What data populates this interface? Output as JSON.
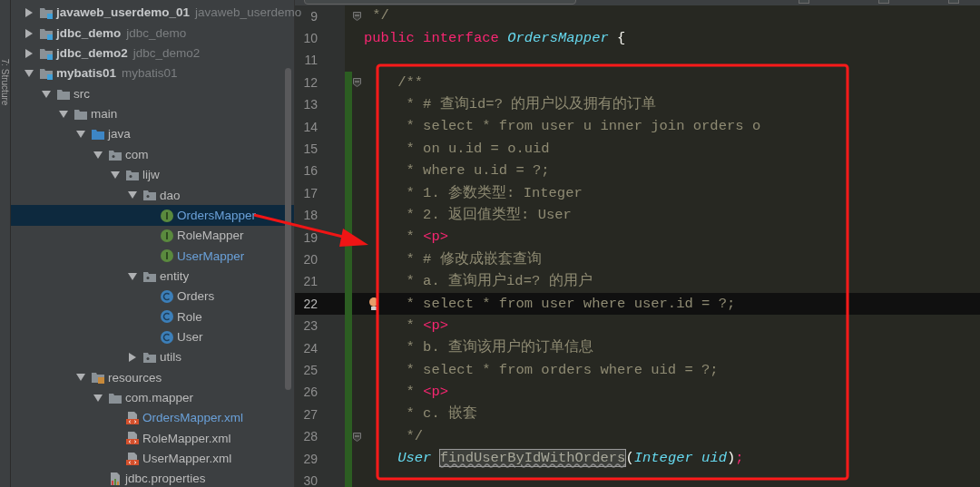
{
  "tool_strip": {
    "label": "7: Structure"
  },
  "project_tree": [
    {
      "label": "javaweb_userdemo_01",
      "secondary": "javaweb_userdemo",
      "kind": "module",
      "expanded": false,
      "modified": false
    },
    {
      "label": "jdbc_demo",
      "secondary": "jdbc_demo",
      "kind": "module",
      "expanded": false,
      "modified": false
    },
    {
      "label": "jdbc_demo2",
      "secondary": "jdbc_demo2",
      "kind": "module",
      "expanded": false,
      "modified": false
    },
    {
      "label": "mybatis01",
      "secondary": "mybatis01",
      "kind": "module",
      "expanded": true,
      "modified": false,
      "children": [
        {
          "label": "src",
          "kind": "folder",
          "expanded": true,
          "modified": false,
          "children": [
            {
              "label": "main",
              "kind": "folder",
              "expanded": true,
              "modified": false,
              "children": [
                {
                  "label": "java",
                  "kind": "source",
                  "expanded": true,
                  "modified": false,
                  "children": [
                    {
                      "label": "com",
                      "kind": "package",
                      "expanded": true,
                      "modified": false,
                      "children": [
                        {
                          "label": "lijw",
                          "kind": "package",
                          "expanded": true,
                          "modified": false,
                          "children": [
                            {
                              "label": "dao",
                              "kind": "package",
                              "expanded": true,
                              "modified": false,
                              "children": [
                                {
                                  "label": "OrdersMapper",
                                  "kind": "interface",
                                  "selected": true,
                                  "modified": true
                                },
                                {
                                  "label": "RoleMapper",
                                  "kind": "interface",
                                  "selected": false,
                                  "modified": false
                                },
                                {
                                  "label": "UserMapper",
                                  "kind": "interface",
                                  "selected": false,
                                  "modified": true
                                }
                              ]
                            },
                            {
                              "label": "entity",
                              "kind": "package",
                              "expanded": true,
                              "modified": false,
                              "children": [
                                {
                                  "label": "Orders",
                                  "kind": "class",
                                  "selected": false,
                                  "modified": false
                                },
                                {
                                  "label": "Role",
                                  "kind": "class",
                                  "selected": false,
                                  "modified": false
                                },
                                {
                                  "label": "User",
                                  "kind": "class",
                                  "selected": false,
                                  "modified": false
                                }
                              ]
                            },
                            {
                              "label": "utils",
                              "kind": "package",
                              "expanded": false,
                              "modified": false
                            }
                          ]
                        }
                      ]
                    }
                  ]
                },
                {
                  "label": "resources",
                  "kind": "resources",
                  "expanded": true,
                  "modified": false,
                  "children": [
                    {
                      "label": "com.mapper",
                      "kind": "folder",
                      "expanded": true,
                      "modified": false,
                      "children": [
                        {
                          "label": "OrdersMapper.xml",
                          "kind": "xml",
                          "selected": false,
                          "modified": true
                        },
                        {
                          "label": "RoleMapper.xml",
                          "kind": "xml",
                          "selected": false,
                          "modified": false
                        },
                        {
                          "label": "UserMapper.xml",
                          "kind": "xml",
                          "selected": false,
                          "modified": false
                        }
                      ]
                    },
                    {
                      "label": "jdbc.properties",
                      "kind": "properties",
                      "selected": false,
                      "modified": false
                    }
                  ]
                }
              ]
            }
          ]
        }
      ]
    }
  ],
  "editor": {
    "lines": [
      {
        "number": "9",
        "fold": true,
        "changed": false,
        "current": false,
        "tokens": [
          {
            "text": " */",
            "kind": "comment"
          }
        ]
      },
      {
        "number": "10",
        "fold": false,
        "changed": false,
        "current": false,
        "tokens": [
          {
            "text": "public",
            "kind": "keyword"
          },
          {
            "text": " interface",
            "kind": "keyword"
          },
          {
            "text": " OrdersMapper",
            "kind": "type"
          },
          {
            "text": " {",
            "kind": "plain"
          }
        ]
      },
      {
        "number": "11",
        "fold": false,
        "changed": false,
        "current": false
      },
      {
        "number": "12",
        "fold": true,
        "changed": true,
        "current": false,
        "tokens": [
          {
            "text": "    /**",
            "kind": "comment"
          }
        ]
      },
      {
        "number": "13",
        "fold": false,
        "changed": true,
        "current": false,
        "tokens": [
          {
            "text": "     * # 查询id=? 的用户以及拥有的订单",
            "kind": "comment"
          }
        ]
      },
      {
        "number": "14",
        "fold": false,
        "changed": true,
        "current": false,
        "tokens": [
          {
            "text": "     * select * from user u inner join orders o",
            "kind": "comment"
          }
        ]
      },
      {
        "number": "15",
        "fold": false,
        "changed": true,
        "current": false,
        "tokens": [
          {
            "text": "     * on u.id = o.uid",
            "kind": "comment"
          }
        ]
      },
      {
        "number": "16",
        "fold": false,
        "changed": true,
        "current": false,
        "tokens": [
          {
            "text": "     * where u.id = ?;",
            "kind": "comment"
          }
        ]
      },
      {
        "number": "17",
        "fold": false,
        "changed": true,
        "current": false,
        "tokens": [
          {
            "text": "     * 1. 参数类型: Integer",
            "kind": "comment"
          }
        ]
      },
      {
        "number": "18",
        "fold": false,
        "changed": true,
        "current": false,
        "tokens": [
          {
            "text": "     * 2. 返回值类型: User",
            "kind": "comment"
          }
        ]
      },
      {
        "number": "19",
        "fold": false,
        "changed": true,
        "current": false,
        "tokens": [
          {
            "text": "     * ",
            "kind": "comment"
          },
          {
            "text": "<p>",
            "kind": "tag"
          }
        ]
      },
      {
        "number": "20",
        "fold": false,
        "changed": true,
        "current": false,
        "tokens": [
          {
            "text": "     * # 修改成嵌套查询",
            "kind": "comment"
          }
        ]
      },
      {
        "number": "21",
        "fold": false,
        "changed": true,
        "current": false,
        "tokens": [
          {
            "text": "     * a. 查询用户id=? 的用户",
            "kind": "comment"
          }
        ]
      },
      {
        "number": "22",
        "fold": false,
        "changed": true,
        "current": true,
        "tokens": [
          {
            "text": "     * select * from user where user.id = ?;",
            "kind": "comment"
          }
        ]
      },
      {
        "number": "23",
        "fold": false,
        "changed": true,
        "current": false,
        "tokens": [
          {
            "text": "     * ",
            "kind": "comment"
          },
          {
            "text": "<p>",
            "kind": "tag"
          }
        ]
      },
      {
        "number": "24",
        "fold": false,
        "changed": true,
        "current": false,
        "tokens": [
          {
            "text": "     * b. 查询该用户的订单信息",
            "kind": "comment"
          }
        ]
      },
      {
        "number": "25",
        "fold": false,
        "changed": true,
        "current": false,
        "tokens": [
          {
            "text": "     * select * from orders where uid = ?;",
            "kind": "comment"
          }
        ]
      },
      {
        "number": "26",
        "fold": false,
        "changed": true,
        "current": false,
        "tokens": [
          {
            "text": "     * ",
            "kind": "comment"
          },
          {
            "text": "<p>",
            "kind": "tag"
          }
        ]
      },
      {
        "number": "27",
        "fold": false,
        "changed": true,
        "current": false,
        "tokens": [
          {
            "text": "     * c. 嵌套",
            "kind": "comment"
          }
        ]
      },
      {
        "number": "28",
        "fold": true,
        "changed": true,
        "current": false,
        "tokens": [
          {
            "text": "     */",
            "kind": "comment"
          }
        ]
      },
      {
        "number": "29",
        "fold": false,
        "changed": true,
        "current": false,
        "tokens": [
          {
            "text": "    User ",
            "kind": "type"
          },
          {
            "text": "findUserByIdWithOrders",
            "kind": "highlight"
          },
          {
            "text": "(",
            "kind": "plain"
          },
          {
            "text": "Integer uid",
            "kind": "type"
          },
          {
            "text": ")",
            "kind": "plain"
          },
          {
            "text": ";",
            "kind": "keyword"
          }
        ]
      },
      {
        "number": "30",
        "fold": false,
        "changed": true,
        "current": false
      }
    ]
  }
}
